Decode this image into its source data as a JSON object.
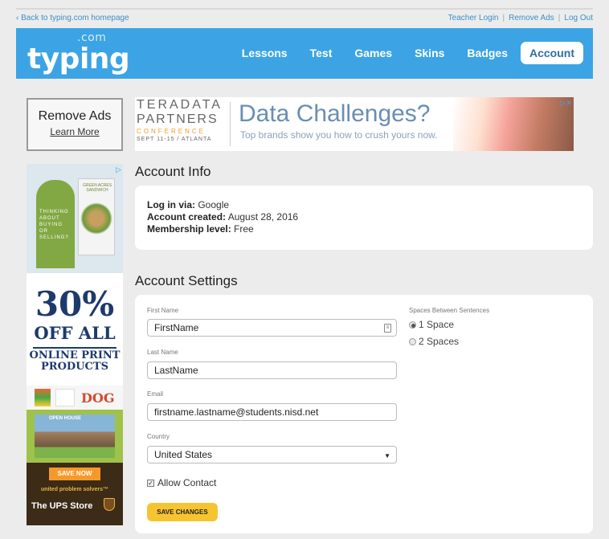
{
  "top_links": {
    "back": "‹ Back to typing.com homepage",
    "teacher_login": "Teacher Login",
    "remove_ads": "Remove Ads",
    "log_out": "Log Out"
  },
  "header": {
    "logo_word": "typing",
    "logo_com": ".com",
    "nav": [
      "Lessons",
      "Test",
      "Games",
      "Skins",
      "Badges"
    ],
    "active": "Account"
  },
  "remove_ads_box": {
    "title": "Remove Ads",
    "link": "Learn More"
  },
  "banner_ad": {
    "brand_line1": "TERADATA",
    "brand_line2": "PARTNERS",
    "brand_line3": "CONFERENCE",
    "brand_line4": "SEPT 11-15 / ATLANTA",
    "headline": "Data Challenges?",
    "subline": "Top brands show you how to crush yours now.",
    "ad_marker": "▷✕"
  },
  "side_ad": {
    "door_text": "THINKING ABOUT BUYING OR SELLING?",
    "sandwich_text": "GREEN ACRES SANDWICH",
    "percent": "30%",
    "off": "OFF ALL",
    "products": "ONLINE PRINT PRODUCTS",
    "card_word": "DOG",
    "open_house": "OPEN HOUSE",
    "save_now": "SAVE NOW",
    "tagline": "united problem solvers™",
    "store": "The UPS Store",
    "ad_marker": "▷"
  },
  "account_info": {
    "heading": "Account Info",
    "login_label": "Log in via:",
    "login_value": "Google",
    "created_label": "Account created:",
    "created_value": "August 28, 2016",
    "membership_label": "Membership level:",
    "membership_value": "Free"
  },
  "account_settings": {
    "heading": "Account Settings",
    "first_name_label": "First Name",
    "first_name_value": "FirstName",
    "last_name_label": "Last Name",
    "last_name_value": "LastName",
    "email_label": "Email",
    "email_value": "firstname.lastname@students.nisd.net",
    "country_label": "Country",
    "country_value": "United States",
    "spaces_label": "Spaces Between Sentences",
    "space_option_1": "1 Space",
    "space_option_2": "2 Spaces",
    "allow_contact": "Allow Contact",
    "save_button": "SAVE CHANGES"
  }
}
